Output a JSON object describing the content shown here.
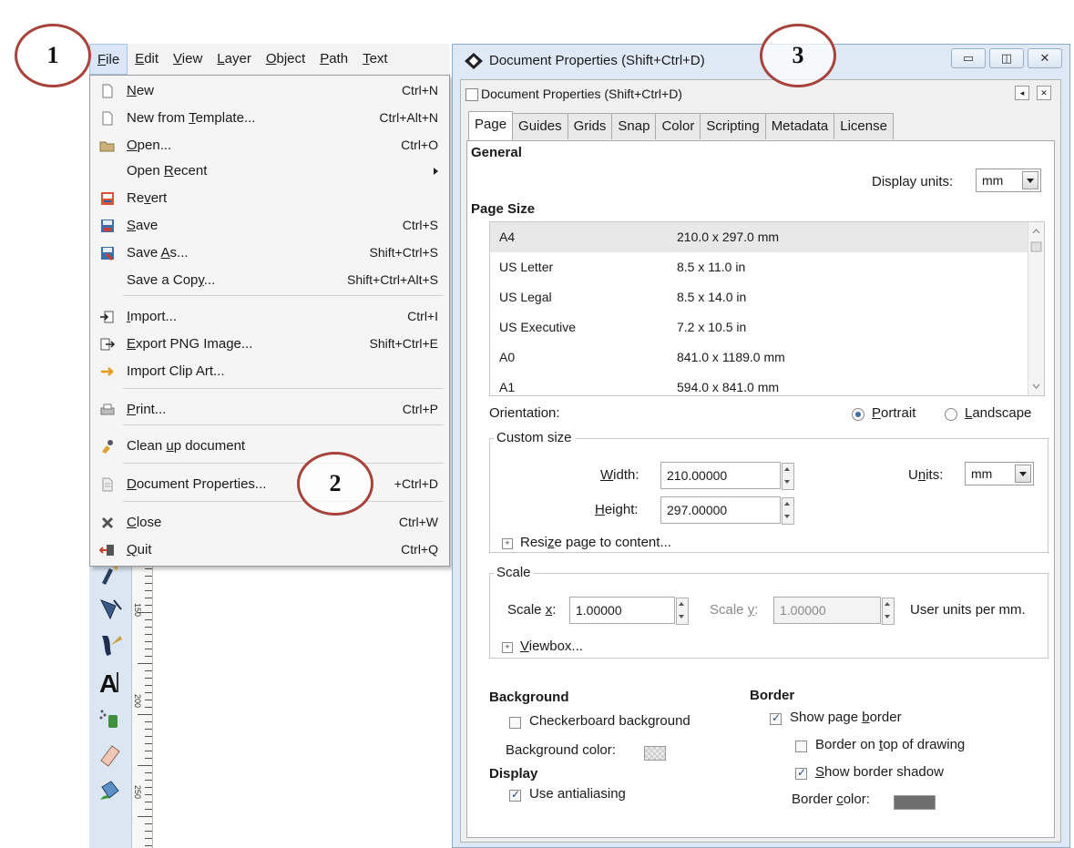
{
  "menubar": {
    "items": [
      {
        "label": "File",
        "accel": "F",
        "rest": "ile"
      },
      {
        "label": "Edit",
        "accel": "E",
        "rest": "dit"
      },
      {
        "label": "View",
        "accel": "V",
        "rest": "iew"
      },
      {
        "label": "Layer",
        "accel": "L",
        "rest": "ayer"
      },
      {
        "label": "Object",
        "accel": "O",
        "rest": "bject"
      },
      {
        "label": "Path",
        "accel": "P",
        "rest": "ath"
      },
      {
        "label": "Text",
        "accel": "T",
        "rest": "ext"
      }
    ]
  },
  "file_menu": {
    "items": [
      {
        "pre": "",
        "accel": "N",
        "post": "ew",
        "shortcut": "Ctrl+N",
        "icon": "new-document-icon"
      },
      {
        "pre": "New from ",
        "accel": "T",
        "post": "emplate...",
        "shortcut": "Ctrl+Alt+N",
        "icon": "new-from-template-icon"
      },
      {
        "pre": "",
        "accel": "O",
        "post": "pen...",
        "shortcut": "Ctrl+O",
        "icon": "open-folder-icon"
      },
      {
        "pre": "Open ",
        "accel": "R",
        "post": "ecent",
        "shortcut": "",
        "icon": ""
      },
      {
        "pre": "Re",
        "accel": "v",
        "post": "ert",
        "shortcut": "",
        "icon": "revert-icon"
      },
      {
        "pre": "",
        "accel": "S",
        "post": "ave",
        "shortcut": "Ctrl+S",
        "icon": "save-icon"
      },
      {
        "pre": "Save ",
        "accel": "A",
        "post": "s...",
        "shortcut": "Shift+Ctrl+S",
        "icon": "save-as-icon"
      },
      {
        "pre": "Save a Cop",
        "accel": "y",
        "post": "...",
        "shortcut": "Shift+Ctrl+Alt+S",
        "icon": ""
      },
      {
        "pre": "",
        "accel": "I",
        "post": "mport...",
        "shortcut": "Ctrl+I",
        "icon": "import-icon"
      },
      {
        "pre": "",
        "accel": "E",
        "post": "xport PNG Image...",
        "shortcut": "Shift+Ctrl+E",
        "icon": "export-png-icon"
      },
      {
        "pre": "Import Clip Art...",
        "accel": "",
        "post": "",
        "shortcut": "",
        "icon": "import-clip-art-icon"
      },
      {
        "pre": "",
        "accel": "P",
        "post": "rint...",
        "shortcut": "Ctrl+P",
        "icon": "print-icon"
      },
      {
        "pre": "Clean ",
        "accel": "u",
        "post": "p document",
        "shortcut": "",
        "icon": "clean-up-icon"
      },
      {
        "pre": "",
        "accel": "D",
        "post": "ocument Properties...",
        "shortcut": "+Ctrl+D",
        "icon": "document-properties-icon"
      },
      {
        "pre": "",
        "accel": "C",
        "post": "lose",
        "shortcut": "Ctrl+W",
        "icon": "close-document-icon"
      },
      {
        "pre": "",
        "accel": "Q",
        "post": "uit",
        "shortcut": "Ctrl+Q",
        "icon": "quit-icon"
      }
    ]
  },
  "window": {
    "title": "Document Properties (Shift+Ctrl+D)",
    "dock_title": "Document Properties (Shift+Ctrl+D)"
  },
  "tabs": [
    "Page",
    "Guides",
    "Grids",
    "Snap",
    "Color",
    "Scripting",
    "Metadata",
    "License"
  ],
  "page": {
    "general_label": "General",
    "display_units_label": "Display units:",
    "display_units_accel": "u",
    "display_units_value": "mm",
    "page_size_label": "Page Size",
    "page_sizes": [
      {
        "name": "A4",
        "dims": "210.0 x 297.0 mm"
      },
      {
        "name": "US Letter",
        "dims": "8.5 x 11.0 in"
      },
      {
        "name": "US Legal",
        "dims": "8.5 x 14.0 in"
      },
      {
        "name": "US Executive",
        "dims": "7.2 x 10.5 in"
      },
      {
        "name": "A0",
        "dims": "841.0 x 1189.0 mm"
      },
      {
        "name": "A1",
        "dims": "594.0 x 841.0 mm"
      }
    ],
    "orientation_label": "Orientation:",
    "portrait": "Portrait",
    "landscape": "Landscape",
    "custom_size_label": "Custom size",
    "width_label": "Width:",
    "width_value": "210.00000",
    "height_label": "Height:",
    "height_value": "297.00000",
    "units_label": "Units:",
    "units_value": "mm",
    "resize_label": "Resize page to content...",
    "scale_label": "Scale",
    "scale_x_label": "Scale x:",
    "scale_x_value": "1.00000",
    "scale_y_label": "Scale y:",
    "scale_y_value": "1.00000",
    "user_units_label": "User units per mm.",
    "viewbox_label": "Viewbox...",
    "background_label": "Background",
    "checkerboard_label": "Checkerboard background",
    "checkerboard_checked": false,
    "bg_color_label": "Background color:",
    "display_label": "Display",
    "antialias_label": "Use antialiasing",
    "antialias_checked": true,
    "border_label": "Border",
    "show_border_label": "Show page border",
    "show_border_checked": true,
    "border_top_label": "Border on top of drawing",
    "border_top_checked": false,
    "border_shadow_label": "Show border shadow",
    "border_shadow_checked": true,
    "border_color_label": "Border color:",
    "border_color": "#6e6e6e"
  },
  "annotations": [
    "1",
    "2",
    "3"
  ],
  "ruler": {
    "labels": [
      "150",
      "200",
      "250"
    ]
  }
}
